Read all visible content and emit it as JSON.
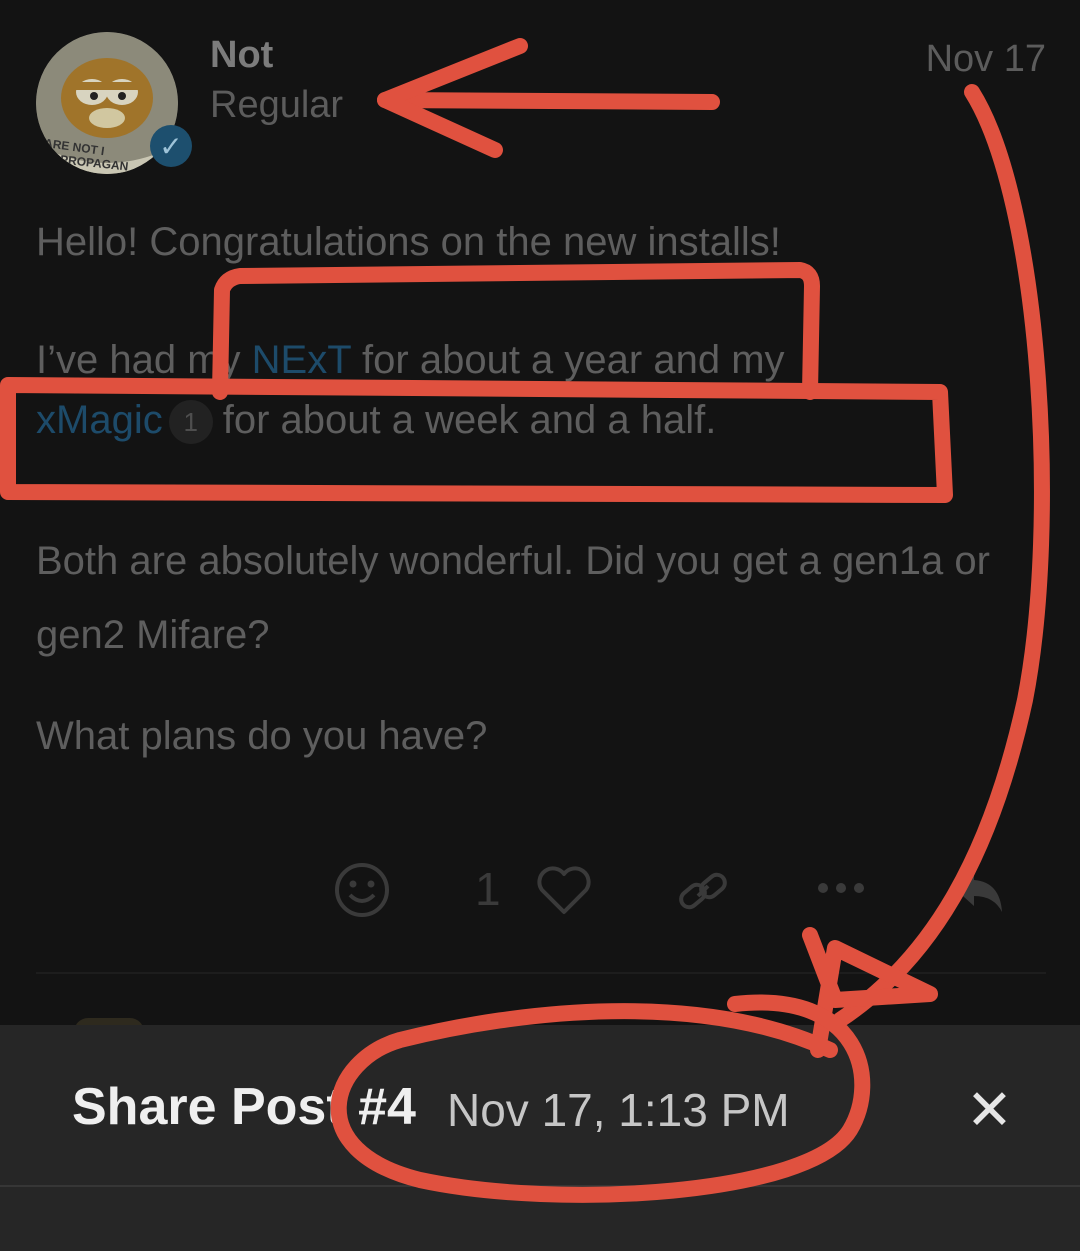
{
  "post": {
    "username": "Not",
    "user_title": "Regular",
    "date": "Nov 17",
    "avatar_text": [
      "ARE NOT I",
      "PROPAGAN"
    ],
    "badge_icon": "✓",
    "paragraphs": {
      "p1": "Hello! Congratulations on the new installs!",
      "p2a": "I’ve had my ",
      "p2_link": "NExT",
      "p2b": " for about a year and my",
      "p2_link2": "xMagic",
      "p2_count": "1",
      "p2c": "for about a week and a half.",
      "p3": "Both are absolutely wonderful. Did you get a gen1a or gen2 Mifare?",
      "p4": "What plans do you have?"
    },
    "actions": {
      "like_count": "1",
      "icons": [
        "emoji-icon",
        "heart-icon",
        "link-icon",
        "more-icon",
        "reply-icon"
      ]
    }
  },
  "share_sheet": {
    "title": "Share Post #4",
    "timestamp": "Nov 17, 1:13 PM",
    "close": "✕"
  },
  "colors": {
    "annotation": "#e0513f",
    "link": "#1d4b6a",
    "sheet_bg": "#262626"
  }
}
